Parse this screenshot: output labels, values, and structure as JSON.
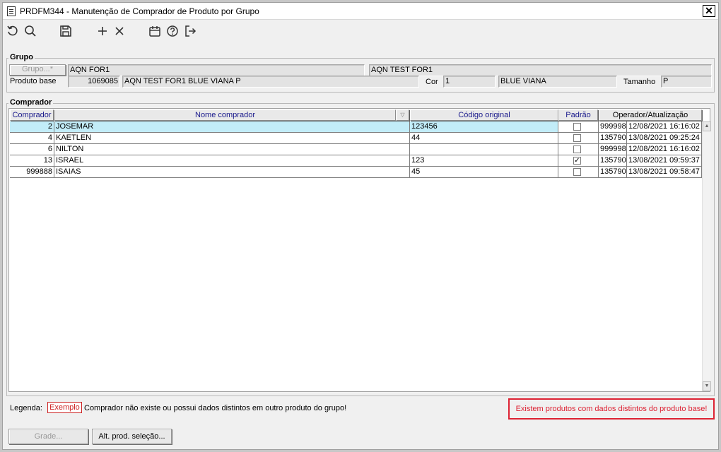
{
  "window": {
    "title": "PRDFM344 - Manutenção de Comprador de Produto por Grupo",
    "close_label": "✕"
  },
  "toolbar": {
    "icons": [
      "refresh-icon",
      "search-icon",
      "save-icon",
      "add-icon",
      "delete-icon",
      "calendar-icon",
      "help-icon",
      "exit-icon"
    ]
  },
  "grupo": {
    "section_label": "Grupo",
    "button_label": "Grupo...*",
    "group_code": "AQN FOR1",
    "group_name": "AQN TEST FOR1",
    "produto_base_label": "Produto base",
    "produto_base_code": "1069085",
    "produto_base_desc": "AQN TEST FOR1 BLUE VIANA P",
    "cor_label": "Cor",
    "cor_code": "1",
    "cor_desc": "BLUE VIANA",
    "tamanho_label": "Tamanho",
    "tamanho_value": "P"
  },
  "comprador": {
    "section_label": "Comprador",
    "columns": {
      "comprador": "Comprador",
      "nome": "Nome comprador",
      "sort": "▽",
      "codigo": "Código original",
      "padrao": "Padrão",
      "operador": "Operador/Atualização"
    },
    "rows": [
      {
        "comprador": "2",
        "nome": "JOSEMAR",
        "codigo": "123456",
        "padrao": false,
        "operador": "999998",
        "atualizacao": "12/08/2021 16:16:02"
      },
      {
        "comprador": "4",
        "nome": "KAETLEN",
        "codigo": "44",
        "padrao": false,
        "operador": "135790",
        "atualizacao": "13/08/2021 09:25:24"
      },
      {
        "comprador": "6",
        "nome": "NILTON",
        "codigo": "",
        "padrao": false,
        "operador": "999998",
        "atualizacao": "12/08/2021 16:16:02"
      },
      {
        "comprador": "13",
        "nome": "ISRAEL",
        "codigo": "123",
        "padrao": true,
        "operador": "135790",
        "atualizacao": "13/08/2021 09:59:37"
      },
      {
        "comprador": "999888",
        "nome": "ISAIAS",
        "codigo": "45",
        "padrao": false,
        "operador": "135790",
        "atualizacao": "13/08/2021 09:58:47"
      }
    ],
    "selected_row": 0
  },
  "legenda": {
    "label": "Legenda:",
    "sample": "Exemplo",
    "text": "Comprador não existe ou possui dados distintos em outro produto do grupo!",
    "warning": "Existem produtos com dados distintos do produto base!"
  },
  "buttons": {
    "grade": "Grade...",
    "alt_prod": "Alt. prod. seleção..."
  },
  "colors": {
    "selected_row": "#c2ecf8",
    "warning": "#d22233",
    "header_text": "#1a1a8c"
  }
}
